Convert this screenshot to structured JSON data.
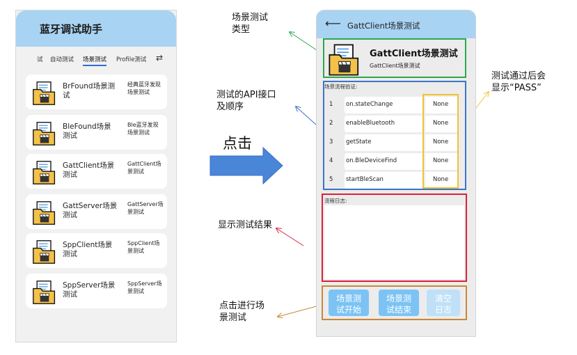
{
  "left_app": {
    "title": "蓝牙调试助手",
    "tabs": [
      "试",
      "自动测试",
      "场景测试",
      "Profile测试"
    ],
    "tab_active": "场景测试",
    "scenes": [
      {
        "name": "BrFound场景测试",
        "desc": "经典蓝牙发现场景测试"
      },
      {
        "name": "BleFound场景测试",
        "desc": "Ble蓝牙发现场景测试"
      },
      {
        "name": "GattClient场景测试",
        "desc": "GattClient场景测试"
      },
      {
        "name": "GattServer场景测试",
        "desc": "GattServer场景测试"
      },
      {
        "name": "SppClient场景测试",
        "desc": "SppClient场景测试"
      },
      {
        "name": "SppServer场景测试",
        "desc": "SppServer场景测试"
      }
    ]
  },
  "annotations": {
    "scene_type": "场景测试\n类型",
    "api_order": "测试的API接口\n及顺序",
    "click": "点击",
    "show_result": "显示测试结果",
    "click_to_test": "点击进行场\n景测试",
    "pass_note": "测试通过后会\n显示“PASS”"
  },
  "right_app": {
    "header_title": "GattClient场景测试",
    "intro_title": "GattClient场景测试",
    "intro_sub": "GattClient场景测试",
    "flow_label": "场景流程验证:",
    "steps": [
      {
        "num": "1",
        "api": "on.stateChange",
        "result": "None"
      },
      {
        "num": "2",
        "api": "enableBluetooth",
        "result": "None"
      },
      {
        "num": "3",
        "api": "getState",
        "result": "None"
      },
      {
        "num": "4",
        "api": "on.BleDeviceFind",
        "result": "None"
      },
      {
        "num": "5",
        "api": "startBleScan",
        "result": "None"
      }
    ],
    "log_label": "流程日志:",
    "buttons": {
      "start": "场景测\n试开始",
      "end": "场景测\n试结束",
      "clear": "清空\n日志"
    }
  },
  "colors": {
    "header_bg": "#a8d3f3",
    "button_bg": "#7cc3f4",
    "scene_type_box": "#2aa94e",
    "api_box": "#3a74c8",
    "result_box": "#f2c230",
    "log_box": "#d8223a",
    "buttons_box": "#c8873a",
    "tab_underline": "#2f6dd6"
  }
}
